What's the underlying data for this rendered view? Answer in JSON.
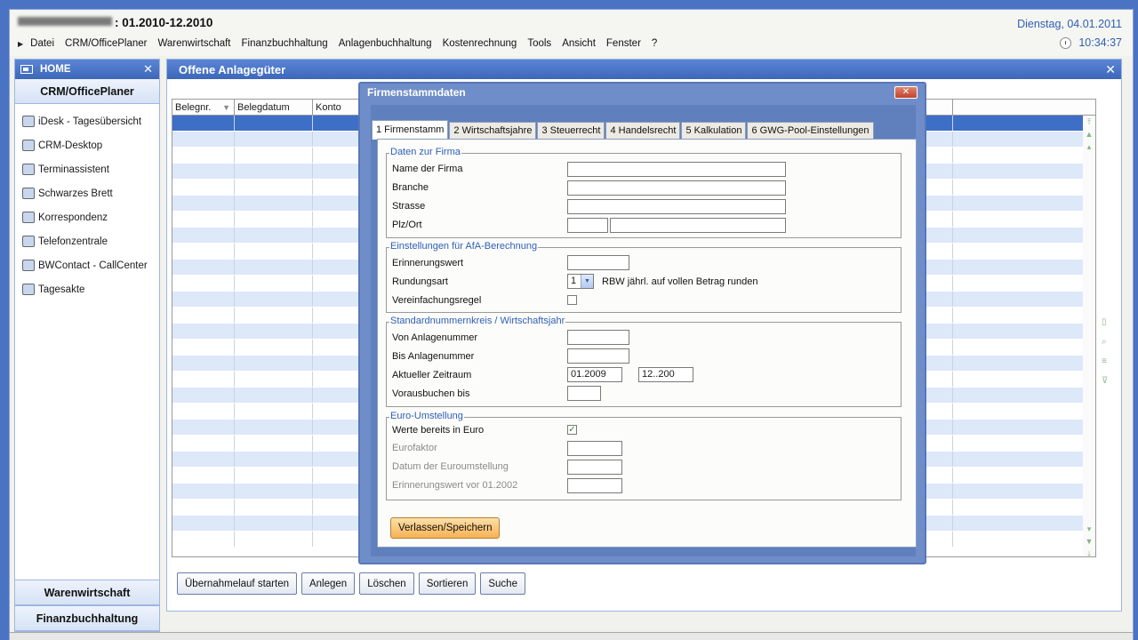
{
  "app": {
    "title_suffix": ": 01.2010-12.2010",
    "date": "Dienstag, 04.01.2011",
    "time": "10:34:37"
  },
  "menu": [
    "Datei",
    "CRM/OfficePlaner",
    "Warenwirtschaft",
    "Finanzbuchhaltung",
    "Anlagenbuchhaltung",
    "Kostenrechnung",
    "Tools",
    "Ansicht",
    "Fenster",
    "?"
  ],
  "sidebar": {
    "header": "HOME",
    "section": "CRM/OfficePlaner",
    "items": [
      {
        "label": "iDesk - Tagesübersicht",
        "icon": "desk-icon"
      },
      {
        "label": "CRM-Desktop",
        "icon": "calendar-icon"
      },
      {
        "label": "Terminassistent",
        "icon": "wizard-icon"
      },
      {
        "label": "Schwarzes Brett",
        "icon": "board-icon"
      },
      {
        "label": "Korrespondenz",
        "icon": "contacts-icon"
      },
      {
        "label": "Telefonzentrale",
        "icon": "phone-icon"
      },
      {
        "label": "BWContact - CallCenter",
        "icon": "callcenter-icon"
      },
      {
        "label": "Tagesakte",
        "icon": "file-icon"
      }
    ],
    "bottom_sections": [
      "Warenwirtschaft",
      "Finanzbuchhaltung"
    ]
  },
  "panel": {
    "title": "Offene Anlagegüter",
    "columns": [
      "Belegnr.",
      "Belegdatum",
      "Konto"
    ],
    "buttons": [
      "Übernahmelauf starten",
      "Anlegen",
      "Löschen",
      "Sortieren",
      "Suche"
    ]
  },
  "dialog": {
    "title": "Firmenstammdaten",
    "tabs": [
      "1 Firmenstamm",
      "2 Wirtschaftsjahre",
      "3 Steuerrecht",
      "4 Handelsrecht",
      "5 Kalkulation",
      "6 GWG-Pool-Einstellungen"
    ],
    "sections": {
      "firma": {
        "legend": "Daten zur Firma",
        "name_label": "Name der Firma",
        "branche_label": "Branche",
        "strasse_label": "Strasse",
        "plz_label": "Plz/Ort"
      },
      "afa": {
        "legend": "Einstellungen für AfA-Berechnung",
        "erinnerung_label": "Erinnerungswert",
        "rundung_label": "Rundungsart",
        "rundung_value": "1",
        "rundung_text": "RBW jährl. auf vollen Betrag runden",
        "vereinfachung_label": "Vereinfachungsregel"
      },
      "nummern": {
        "legend": "Standardnummernkreis / Wirtschaftsjahr",
        "von_label": "Von Anlagenummer",
        "bis_label": "Bis Anlagenummer",
        "zeitraum_label": "Aktueller Zeitraum",
        "zeitraum_von": "01.2009",
        "zeitraum_bis": "12..200",
        "voraus_label": "Vorausbuchen bis"
      },
      "euro": {
        "legend": "Euro-Umstellung",
        "werte_label": "Werte bereits in Euro",
        "faktor_label": "Eurofaktor",
        "datum_label": "Datum der Euroumstellung",
        "erinnerung_label": "Erinnerungswert vor 01.2002"
      }
    },
    "save_button": "Verlassen/Speichern"
  }
}
